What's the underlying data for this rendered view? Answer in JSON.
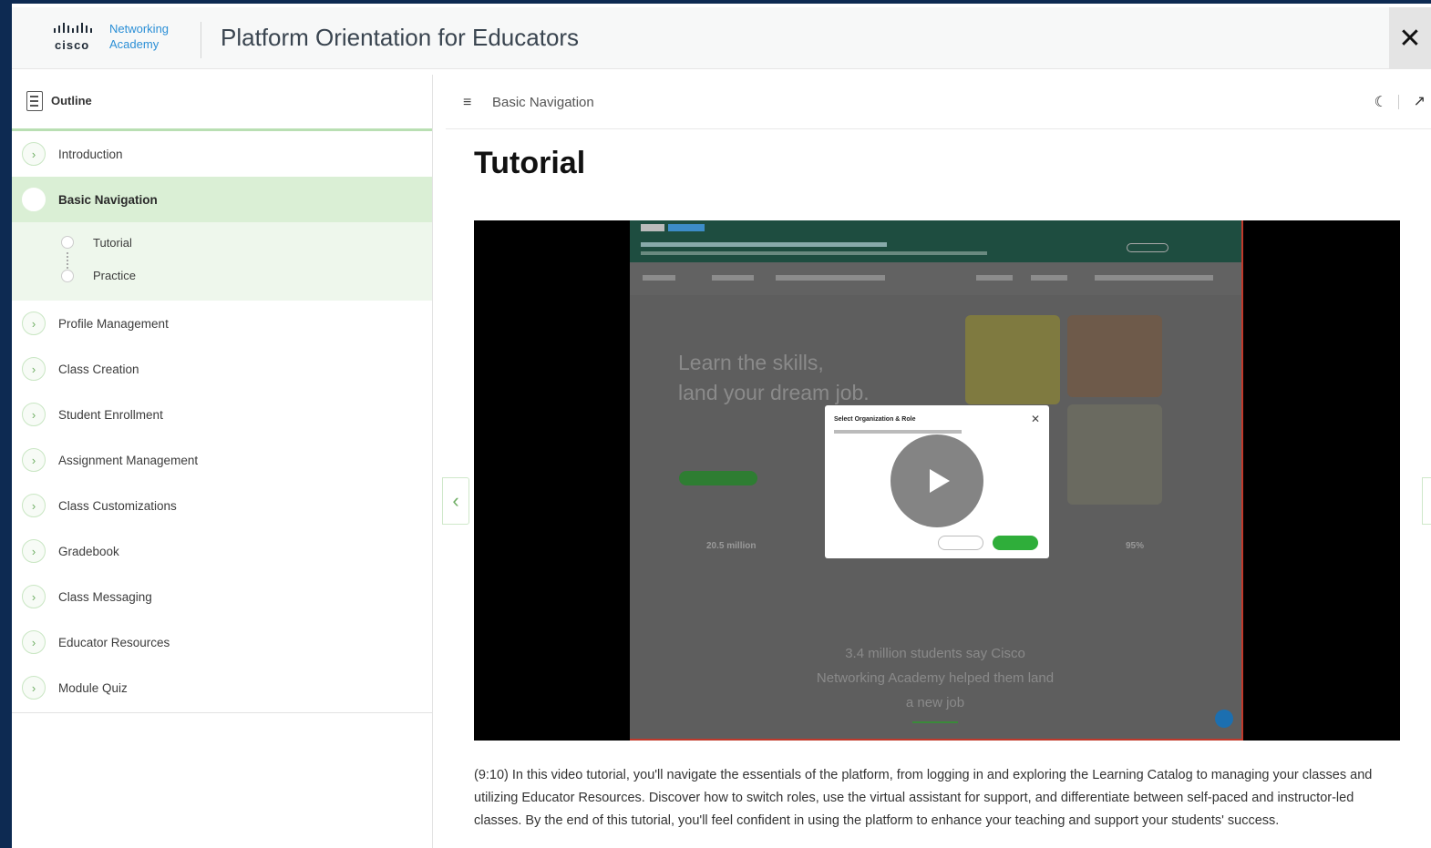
{
  "header": {
    "logo": {
      "cisco": "cisco",
      "line1": "Networking",
      "line2": "Academy"
    },
    "title": "Platform Orientation for Educators",
    "close_glyph": "✕"
  },
  "sidebar": {
    "outline_label": "Outline",
    "items": [
      {
        "label": "Introduction",
        "state": "collapsed"
      },
      {
        "label": "Basic Navigation",
        "state": "active"
      },
      {
        "label": "Profile Management",
        "state": "collapsed"
      },
      {
        "label": "Class Creation",
        "state": "collapsed"
      },
      {
        "label": "Student Enrollment",
        "state": "collapsed"
      },
      {
        "label": "Assignment Management",
        "state": "collapsed"
      },
      {
        "label": "Class Customizations",
        "state": "collapsed"
      },
      {
        "label": "Gradebook",
        "state": "collapsed"
      },
      {
        "label": "Class Messaging",
        "state": "collapsed"
      },
      {
        "label": "Educator Resources",
        "state": "collapsed"
      },
      {
        "label": "Module Quiz",
        "state": "collapsed"
      }
    ],
    "subitems": [
      {
        "label": "Tutorial"
      },
      {
        "label": "Practice"
      }
    ]
  },
  "main": {
    "breadcrumb": "Basic Navigation",
    "page_title": "Tutorial",
    "video": {
      "hero_line1": "Learn the skills,",
      "hero_line2": "land your dream job.",
      "stat": "20.5 million",
      "stat2": "95%",
      "quote": "3.4 million students say Cisco Networking Academy helped them land a new job",
      "modal_title": "Select Organization & Role"
    },
    "description": "(9:10) In this video tutorial, you'll navigate the essentials of the platform, from logging in and exploring the Learning Catalog to managing your classes and utilizing Educator Resources. Discover how to switch roles, use the virtual assistant for support, and differentiate between self-paced and instructor-led classes. By the end of this tutorial, you'll feel confident in using the platform to enhance your teaching and support your students' success."
  },
  "colors": {
    "frame_bg": "#0d2a52",
    "accent_green": "#6fae64",
    "active_bg": "#daefd5"
  },
  "icons": [
    "cisco-logo-icon",
    "close-icon",
    "outline-icon",
    "chevron-right-icon",
    "menu-collapse-icon",
    "dark-mode-icon",
    "expand-icon",
    "chevron-left-icon",
    "play-icon"
  ]
}
